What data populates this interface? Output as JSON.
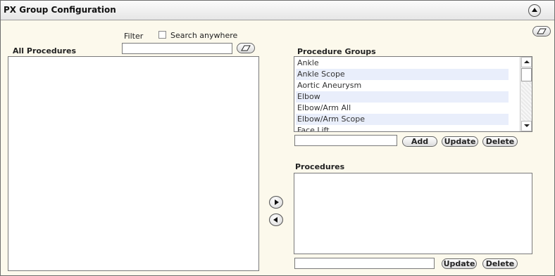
{
  "header": {
    "title": "PX Group Configuration"
  },
  "filter": {
    "label": "Filter",
    "search_anywhere_label": "Search anywhere",
    "search_anywhere_checked": false,
    "value": "",
    "placeholder": ""
  },
  "all_procedures": {
    "label": "All Procedures"
  },
  "procedure_groups": {
    "label": "Procedure Groups",
    "items": [
      "Ankle",
      "Ankle Scope",
      "Aortic Aneurysm",
      "Elbow",
      "Elbow/Arm All",
      "Elbow/Arm Scope",
      "Face Lift"
    ],
    "name_input_value": "",
    "add_label": "Add",
    "update_label": "Update",
    "delete_label": "Delete"
  },
  "procedures": {
    "label": "Procedures",
    "input_value": "",
    "update_label": "Update",
    "delete_label": "Delete"
  },
  "icons": {
    "collapse": "collapse-up-icon",
    "clear": "eraser-icon",
    "move_right": "arrow-right-icon",
    "move_left": "arrow-left-icon"
  },
  "colors": {
    "panel_background": "#fcf9ec",
    "alt_row": "#e9eefb"
  }
}
